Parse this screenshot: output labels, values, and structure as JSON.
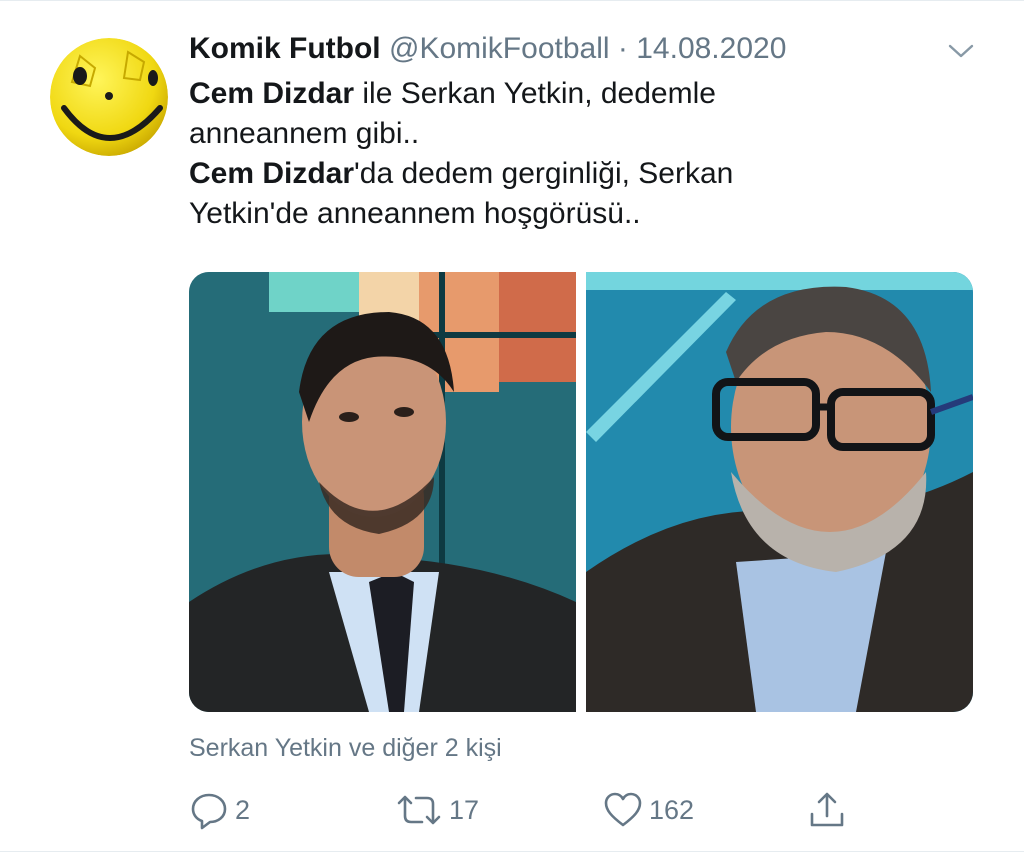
{
  "tweet": {
    "author_name": "Komik Futbol",
    "handle": "@KomikFootball",
    "separator": "·",
    "date": "14.08.2020",
    "text_lines": [
      {
        "bold": "Cem Dizdar",
        "rest": " ile Serkan Yetkin, dedemle"
      },
      {
        "bold": "",
        "rest": "anneannem gibi.."
      },
      {
        "bold": "Cem Dizdar",
        "rest": "'da dedem gerginliği, Serkan"
      },
      {
        "bold": "",
        "rest": "Yetkin'de anneannem hoşgörüsü.."
      }
    ]
  },
  "social_context": "Serkan Yetkin ve diğer 2 kişi",
  "actions": {
    "replies": "2",
    "retweets": "17",
    "likes": "162"
  },
  "icons": {
    "avatar": "smiley-football-avatar",
    "caret": "chevron-down-icon",
    "reply": "reply-icon",
    "retweet": "retweet-icon",
    "like": "heart-icon",
    "share": "share-icon"
  },
  "colors": {
    "text": "#14171a",
    "secondary": "#657786",
    "avatar_yellow": "#f4e11a"
  }
}
